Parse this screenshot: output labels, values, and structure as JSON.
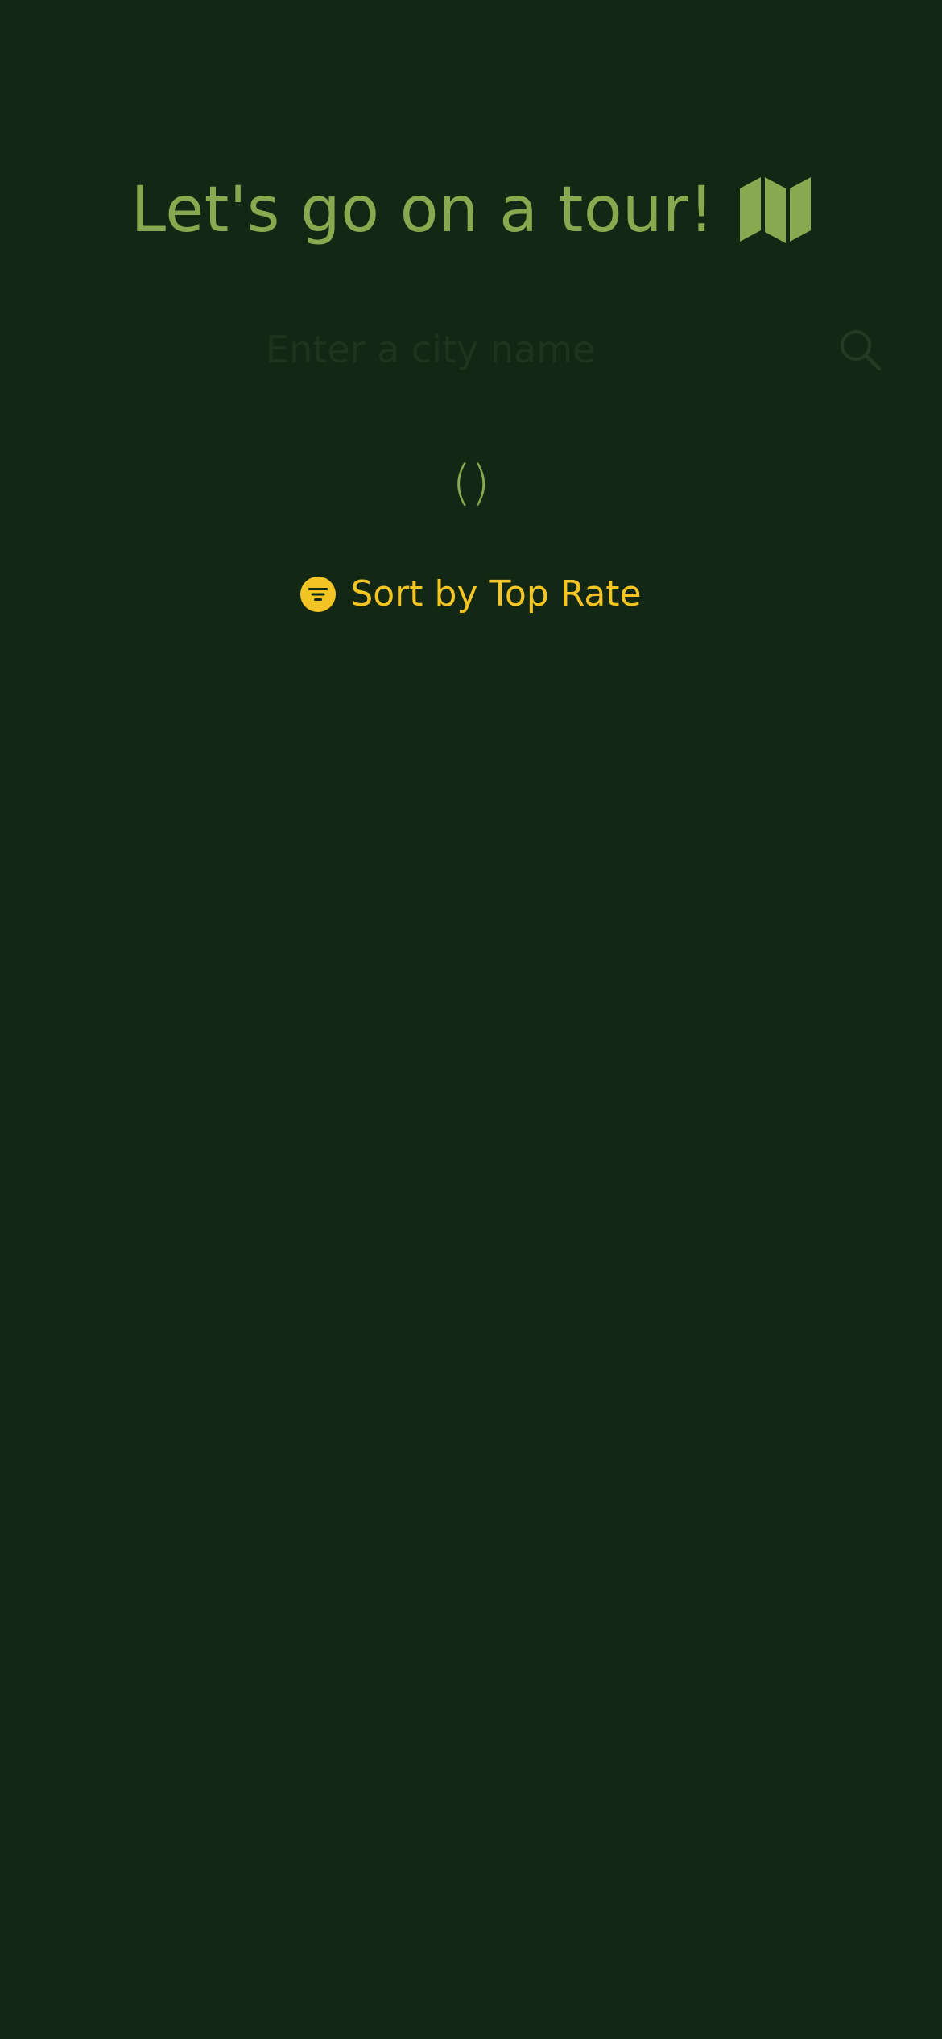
{
  "header": {
    "title": "Let's go on a tour!",
    "icon": "map-icon"
  },
  "search": {
    "placeholder": "Enter a city name",
    "value": "",
    "icon": "search-icon"
  },
  "results": {
    "count_text": "()"
  },
  "sort": {
    "label": "Sort by Top Rate",
    "icon": "filter-icon"
  },
  "colors": {
    "background": "#132814",
    "accent_green": "#8aa84f",
    "accent_yellow": "#f2c525"
  }
}
